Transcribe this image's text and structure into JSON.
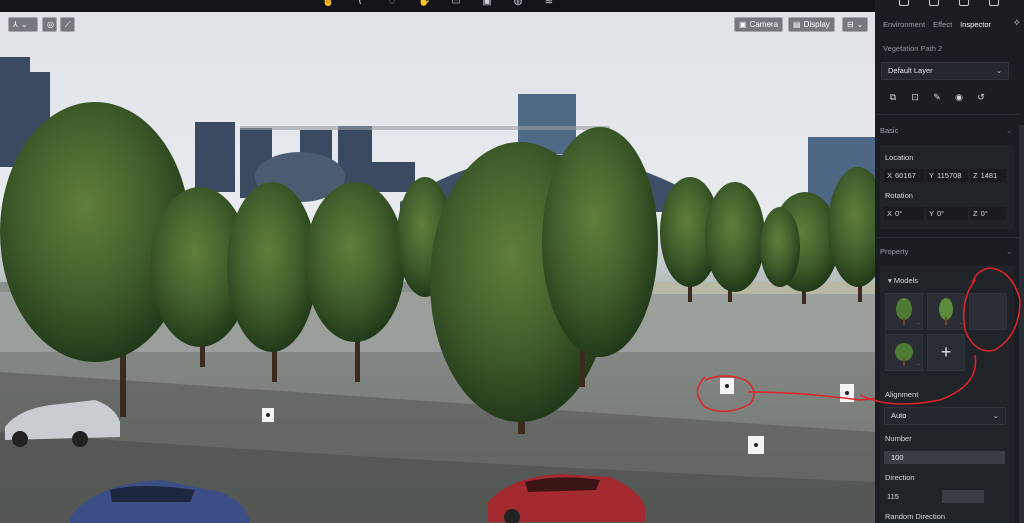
{
  "viewport": {
    "camera_label": "Camera",
    "display_label": "Display"
  },
  "panel": {
    "tabs": [
      {
        "label": "Environment"
      },
      {
        "label": "Effect"
      },
      {
        "label": "Inspector"
      }
    ],
    "object_name": "Vegetation Path 2",
    "layer_select": "Default Layer",
    "basic": {
      "title": "Basic",
      "location_label": "Location",
      "location": {
        "x": "60167",
        "y": "115708",
        "z": "1481"
      },
      "rotation_label": "Rotation",
      "rotation": {
        "x": "0°",
        "y": "0°",
        "z": "0°"
      }
    },
    "property": {
      "title": "Property",
      "models_label": "Models",
      "alignment_label": "Alignment",
      "alignment_value": "Auto",
      "number_label": "Number",
      "number_value": "100",
      "direction_label": "Direction",
      "direction_value": "115",
      "random_direction_label": "Random Direction"
    }
  },
  "axis_letters": {
    "x": "X",
    "y": "Y",
    "z": "Z"
  },
  "colors": {
    "panel_bg": "#1b1d22",
    "annotation_red": "#e0242a"
  }
}
